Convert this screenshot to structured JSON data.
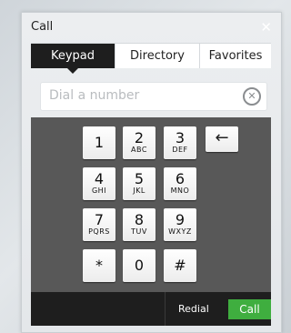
{
  "window": {
    "title": "Call",
    "close_icon": "close-icon"
  },
  "tabs": [
    {
      "label": "Keypad",
      "active": true
    },
    {
      "label": "Directory",
      "active": false
    },
    {
      "label": "Favorites",
      "active": false
    }
  ],
  "dial": {
    "placeholder": "Dial a number",
    "value": "",
    "clear_icon": "clear-circle-icon"
  },
  "keys": [
    {
      "digit": "1",
      "letters": ""
    },
    {
      "digit": "2",
      "letters": "ABC"
    },
    {
      "digit": "3",
      "letters": "DEF"
    },
    {
      "digit": "4",
      "letters": "GHI"
    },
    {
      "digit": "5",
      "letters": "JKL"
    },
    {
      "digit": "6",
      "letters": "MNO"
    },
    {
      "digit": "7",
      "letters": "PQRS"
    },
    {
      "digit": "8",
      "letters": "TUV"
    },
    {
      "digit": "9",
      "letters": "WXYZ"
    },
    {
      "digit": "*",
      "letters": ""
    },
    {
      "digit": "0",
      "letters": ""
    },
    {
      "digit": "#",
      "letters": ""
    }
  ],
  "backspace": {
    "glyph": "←",
    "icon": "backspace-arrow-icon"
  },
  "actions": {
    "redial_label": "Redial",
    "call_label": "Call"
  },
  "colors": {
    "call_green": "#3fae3f",
    "dark": "#1e1e1e",
    "keypad_bg": "#585858"
  }
}
